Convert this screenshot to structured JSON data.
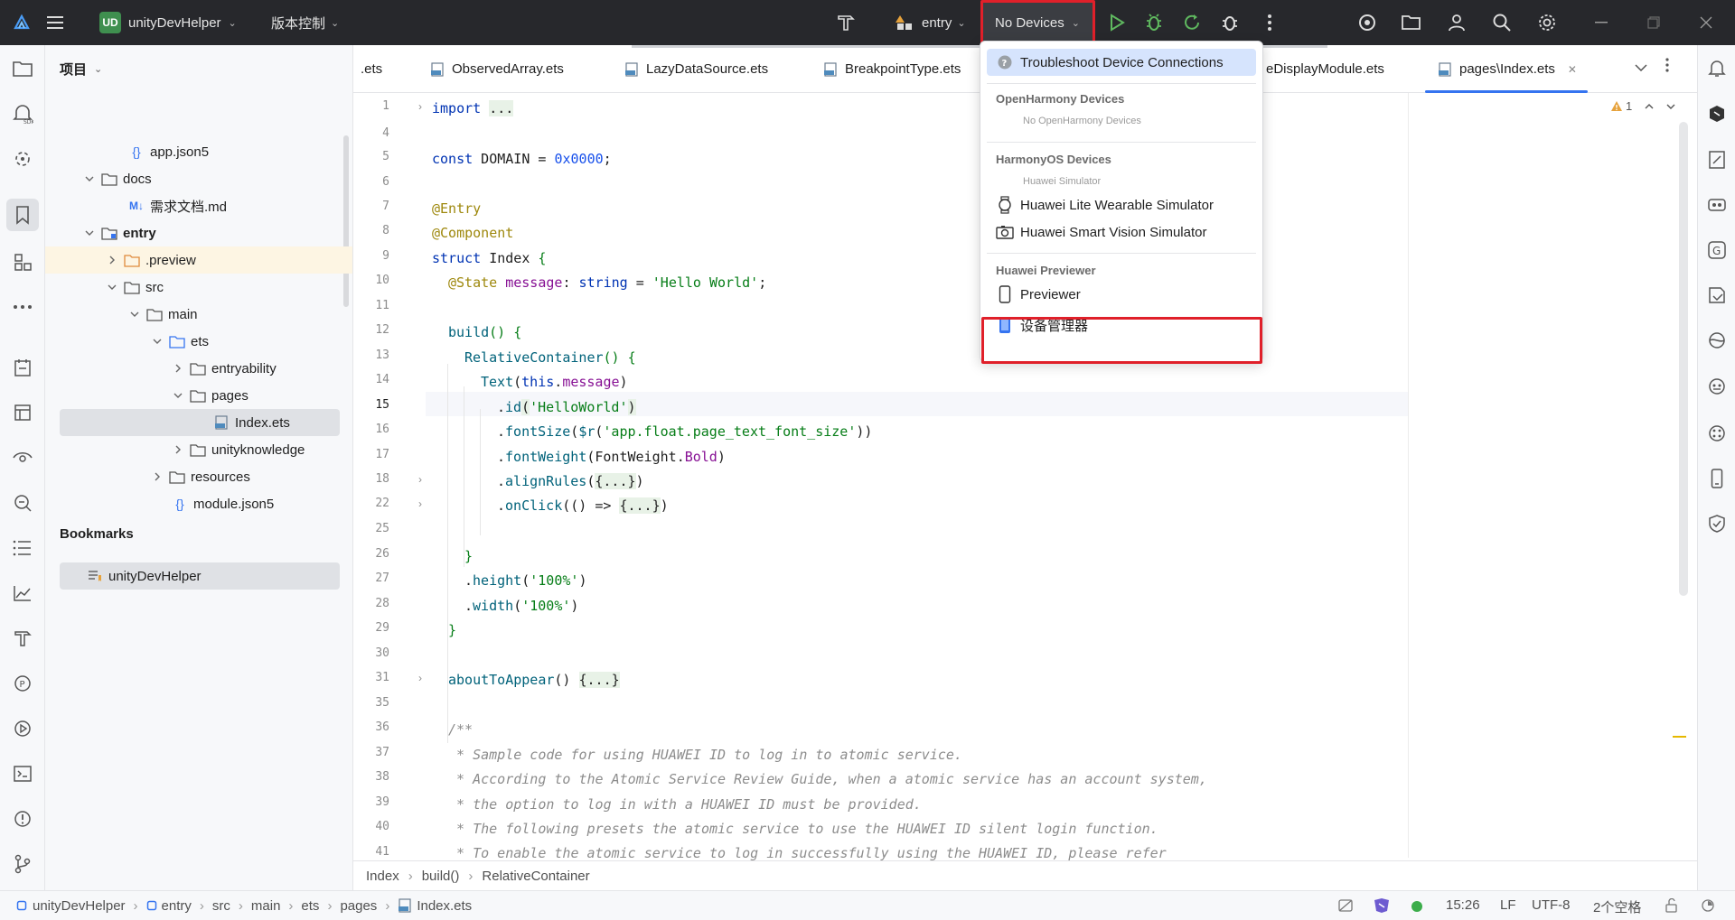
{
  "titlebar": {
    "project_badge": "UD",
    "project_name": "unityDevHelper",
    "vcs_label": "版本控制",
    "module": "entry",
    "device": "No Devices"
  },
  "project_panel": {
    "title": "项目",
    "tree": [
      {
        "label": "app.json5",
        "type": "json",
        "depth": 3
      },
      {
        "label": "docs",
        "type": "folder",
        "depth": 2,
        "expanded": true
      },
      {
        "label": "需求文档.md",
        "type": "md",
        "depth": 3
      },
      {
        "label": "entry",
        "type": "module",
        "depth": 2,
        "expanded": true,
        "bold": true
      },
      {
        "label": ".preview",
        "type": "folder-orange",
        "depth": 3,
        "expanded": false
      },
      {
        "label": "src",
        "type": "folder",
        "depth": 3,
        "expanded": true
      },
      {
        "label": "main",
        "type": "folder",
        "depth": 4,
        "expanded": true
      },
      {
        "label": "ets",
        "type": "folder-blue",
        "depth": 5,
        "expanded": true
      },
      {
        "label": "entryability",
        "type": "folder",
        "depth": 6,
        "expanded": false
      },
      {
        "label": "pages",
        "type": "folder",
        "depth": 6,
        "expanded": true
      },
      {
        "label": "Index.ets",
        "type": "ets",
        "depth": 7
      },
      {
        "label": "unityknowledge",
        "type": "folder",
        "depth": 6,
        "expanded": false
      },
      {
        "label": "resources",
        "type": "folder",
        "depth": 5,
        "expanded": false
      },
      {
        "label": "module.json5",
        "type": "json",
        "depth": 5
      }
    ],
    "bookmarks_title": "Bookmarks",
    "bookmarks": [
      {
        "label": "unityDevHelper"
      }
    ]
  },
  "tabs": [
    {
      "label": ".ets"
    },
    {
      "label": "ObservedArray.ets"
    },
    {
      "label": "LazyDataSource.ets"
    },
    {
      "label": "BreakpointType.ets"
    },
    {
      "label": "eDisplayModule.ets"
    },
    {
      "label": "pages\\Index.ets",
      "active": true
    }
  ],
  "editor": {
    "warning_count": "1",
    "current_line": "15",
    "lines": [
      {
        "n": "1",
        "fold": "›"
      },
      {
        "n": "4"
      },
      {
        "n": "5"
      },
      {
        "n": "6"
      },
      {
        "n": "7"
      },
      {
        "n": "8"
      },
      {
        "n": "9"
      },
      {
        "n": "10"
      },
      {
        "n": "11"
      },
      {
        "n": "12"
      },
      {
        "n": "13"
      },
      {
        "n": "14"
      },
      {
        "n": "15"
      },
      {
        "n": "16"
      },
      {
        "n": "17"
      },
      {
        "n": "18",
        "fold": "›"
      },
      {
        "n": "22",
        "fold": "›"
      },
      {
        "n": "25"
      },
      {
        "n": "26"
      },
      {
        "n": "27"
      },
      {
        "n": "28"
      },
      {
        "n": "29"
      },
      {
        "n": "30"
      },
      {
        "n": "31",
        "fold": "›"
      },
      {
        "n": "35"
      },
      {
        "n": "36"
      },
      {
        "n": "37"
      },
      {
        "n": "38"
      },
      {
        "n": "39"
      },
      {
        "n": "40"
      },
      {
        "n": "41"
      }
    ],
    "code": {
      "l1_kw": "import",
      "l1_fold": "...",
      "l5_kw": "const",
      "l5_name": " DOMAIN = ",
      "l5_num": "0x0000",
      "l5_end": ";",
      "l7": "@Entry",
      "l8": "@Component",
      "l9_kw": "struct",
      "l9_name": " Index ",
      "l9_brace": "{",
      "l10_ann": "@State",
      "l10_prop": " message",
      "l10_mid": ": ",
      "l10_type": "string",
      "l10_eq": " = ",
      "l10_str": "'Hello World'",
      "l10_end": ";",
      "l12_fn": "build",
      "l12_rest": "() {",
      "l13_fn": "RelativeContainer",
      "l13_rest": "() {",
      "l14_fn": "Text",
      "l14_open": "(",
      "l14_this": "this",
      "l14_dot": ".",
      "l14_prop": "message",
      "l14_close": ")",
      "l15_dot": ".",
      "l15_fn": "id",
      "l15_open": "(",
      "l15_str": "'HelloWorld'",
      "l15_close": ")",
      "l16_dot": ".",
      "l16_fn": "fontSize",
      "l16_open": "(",
      "l16_fn2": "$r",
      "l16_open2": "(",
      "l16_str": "'app.float.page_text_font_size'",
      "l16_close": "))",
      "l17_dot": ".",
      "l17_fn": "fontWeight",
      "l17_open": "(",
      "l17_enum": "FontWeight",
      "l17_dot2": ".",
      "l17_prop": "Bold",
      "l17_close": ")",
      "l18_dot": ".",
      "l18_fn": "alignRules",
      "l18_open": "(",
      "l18_fold": "{...}",
      "l18_close": ")",
      "l22_dot": ".",
      "l22_fn": "onClick",
      "l22_open": "(() => ",
      "l22_fold": "{...}",
      "l22_close": ")",
      "l26": "}",
      "l27_dot": ".",
      "l27_fn": "height",
      "l27_open": "(",
      "l27_str": "'100%'",
      "l27_close": ")",
      "l28_dot": ".",
      "l28_fn": "width",
      "l28_open": "(",
      "l28_str": "'100%'",
      "l28_close": ")",
      "l29": "}",
      "l31_fn": "aboutToAppear",
      "l31_open": "() ",
      "l31_fold": "{...}",
      "l36": "/**",
      "l37": " * Sample code for using HUAWEI ID to log in to atomic service.",
      "l38": " * According to the Atomic Service Review Guide, when a atomic service has an account system,",
      "l39": " * the option to log in with a HUAWEI ID must be provided.",
      "l40": " * The following presets the atomic service to use the HUAWEI ID silent login function.",
      "l41": " * To enable the atomic service to log in successfully using the HUAWEI ID, please refer"
    }
  },
  "breadcrumb": [
    "Index",
    "build()",
    "RelativeContainer"
  ],
  "dropdown": {
    "troubleshoot": "Troubleshoot Device Connections",
    "openharmony_head": "OpenHarmony Devices",
    "openharmony_empty": "No OpenHarmony Devices",
    "harmonyos_head": "HarmonyOS Devices",
    "harmonyos_sub": "Huawei Simulator",
    "wearable": "Huawei Lite Wearable Simulator",
    "vision": "Huawei Smart Vision Simulator",
    "previewer_head": "Huawei Previewer",
    "previewer": "Previewer",
    "device_manager": "设备管理器"
  },
  "statusbar": {
    "path": [
      "unityDevHelper",
      "entry",
      "src",
      "main",
      "ets",
      "pages",
      "Index.ets"
    ],
    "position": "15:26",
    "line_sep": "LF",
    "encoding": "UTF-8",
    "indent": "2个空格"
  },
  "colors": {
    "highlight_border": "#e0202a",
    "titlebar_bg": "#27282c",
    "accent": "#3574f0"
  }
}
